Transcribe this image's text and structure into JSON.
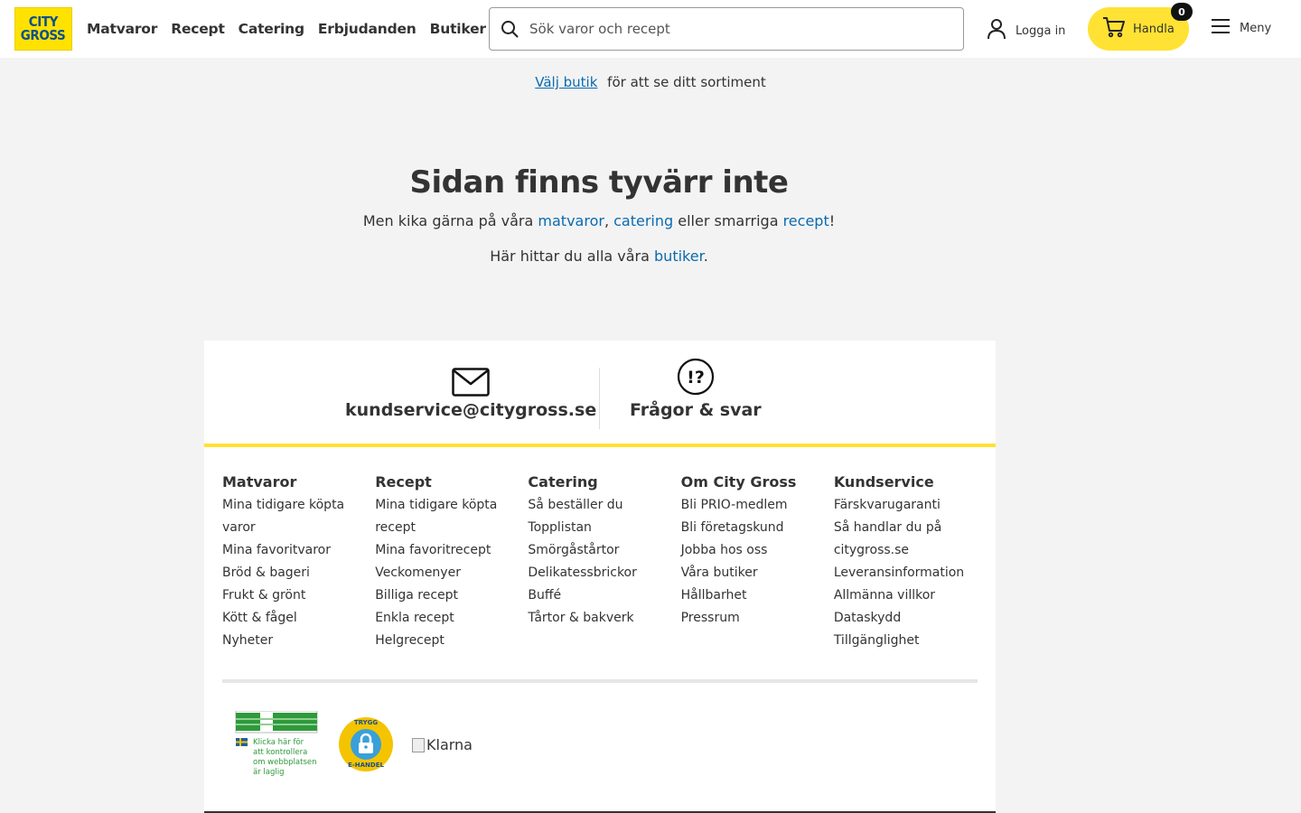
{
  "header": {
    "logo": {
      "line1": "CITY",
      "line2": "GROSS"
    },
    "nav": [
      "Matvaror",
      "Recept",
      "Catering",
      "Erbjudanden",
      "Butiker"
    ],
    "search_placeholder": "Sök varor och recept",
    "login_label": "Logga in",
    "cart_label": "Handla",
    "cart_count": "0",
    "menu_label": "Meny"
  },
  "store_select": {
    "link": "Välj butik",
    "text": "för att se ditt sortiment"
  },
  "not_found": {
    "title": "Sidan finns tyvärr inte",
    "line1_prefix": "Men kika gärna på våra ",
    "line1_link1": "matvaror",
    "line1_sep": ", ",
    "line1_link2": "catering",
    "line1_mid": " eller smarriga ",
    "line1_link3": "recept",
    "line1_suffix": "!",
    "line2_prefix": "Här hittar du alla våra ",
    "line2_link": "butiker",
    "line2_suffix": "."
  },
  "footer": {
    "contact": {
      "email": "kundservice@citygross.se",
      "faq": "Frågor & svar"
    },
    "columns": [
      {
        "title": "Matvaror",
        "links": [
          "Mina tidigare köpta varor",
          "Mina favoritvaror",
          "Bröd & bageri",
          "Frukt & grönt",
          "Kött & fågel",
          "Nyheter"
        ]
      },
      {
        "title": "Recept",
        "links": [
          "Mina tidigare köpta recept",
          "Mina favoritrecept",
          "Veckomenyer",
          "Billiga recept",
          "Enkla recept",
          "Helgrecept"
        ]
      },
      {
        "title": "Catering",
        "links": [
          "Så beställer du",
          "Topplistan",
          "Smörgåstårtor",
          "Delikatessbrickor",
          "Buffé",
          "Tårtor & bakverk"
        ]
      },
      {
        "title": "Om City Gross",
        "links": [
          "Bli PRIO-medlem",
          "Bli företagskund",
          "Jobba hos oss",
          "Våra butiker",
          "Hållbarhet",
          "Pressrum"
        ]
      },
      {
        "title": "Kundservice",
        "links": [
          "Färskvarugaranti",
          "Så handlar du på citygross.se",
          "Leveransinformation",
          "Allmänna villkor",
          "Dataskydd",
          "Tillgänglighet"
        ]
      }
    ],
    "badges": {
      "gov_text": [
        "Klicka här för",
        "att kontrollera",
        "om webbplatsen",
        "är laglig"
      ],
      "trygg_top": "TRYGG",
      "trygg_bottom": "E-HANDEL",
      "klarna_alt": "Klarna"
    }
  }
}
